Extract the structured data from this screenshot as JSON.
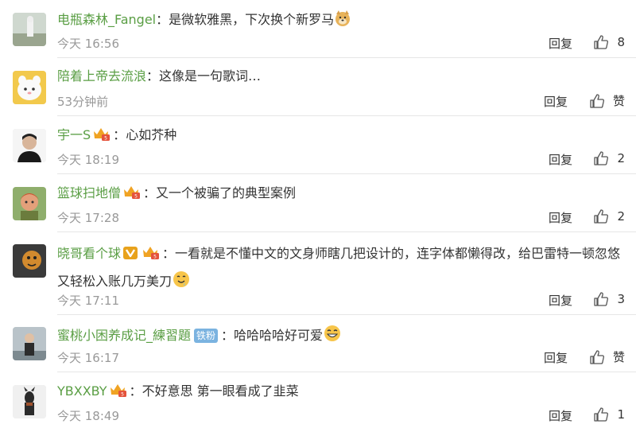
{
  "comments": [
    {
      "user": "电瓶森林_Fangel",
      "text": "是微软雅黑，下次换个新罗马",
      "time": "今天 16:56",
      "reply": "回复",
      "likes": "8"
    },
    {
      "user": "陪着上帝去流浪",
      "text": "这像是一句歌词…",
      "time": "53分钟前",
      "reply": "回复",
      "likes": "赞"
    },
    {
      "user": "宇一S",
      "text": "心如芥种",
      "time": "今天 18:19",
      "reply": "回复",
      "likes": "2"
    },
    {
      "user": "篮球扫地僧",
      "text": "又一个被骗了的典型案例",
      "time": "今天 17:28",
      "reply": "回复",
      "likes": "2"
    },
    {
      "user": "晓哥看个球",
      "text": "一看就是不懂中文的文身师瞎几把设计的，连字体都懒得改，给巴雷特一顿忽悠又轻松入账几万美刀",
      "time": "今天 17:11",
      "reply": "回复",
      "likes": "3"
    },
    {
      "user": "蜜桃小困养成记_練習題",
      "fan_badge": "铁粉",
      "text": "哈哈哈哈好可爱",
      "time": "今天 16:17",
      "reply": "回复",
      "likes": "赞"
    },
    {
      "user": "YBXXBY",
      "text": "不好意思 第一眼看成了韭菜",
      "time": "今天 18:49",
      "reply": "回复",
      "likes": "1"
    }
  ],
  "colors": {
    "username": "#5a9e44",
    "meta": "#999999",
    "divider": "#e6e6e6",
    "vip_badge": "#e8a21c"
  }
}
